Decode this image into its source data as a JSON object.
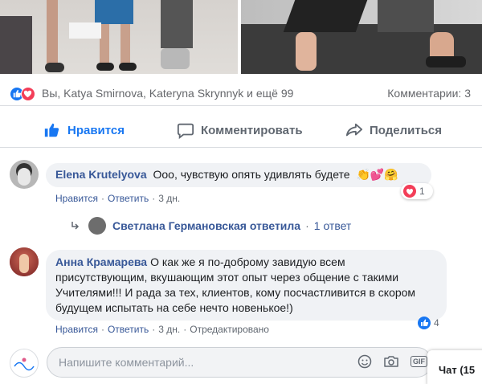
{
  "reactions": {
    "names": "Вы, Katya Smirnova, Kateryna Skrynnyk и ещё 99",
    "comments_count": "Комментарии: 3"
  },
  "actions": {
    "like": "Нравится",
    "comment": "Комментировать",
    "share": "Поделиться"
  },
  "comments": [
    {
      "author": "Elena Krutelyova",
      "text": "Ооо, чувствую опять удивлять будете",
      "emoji": "👏💕🤗",
      "like_label": "Нравится",
      "reply_label": "Ответить",
      "time": "3 дн.",
      "reaction_count": "1"
    },
    {
      "author": "Анна Крамарева",
      "text": "О как же я по-доброму завидую всем присутствующим, вкушающим этот опыт через общение с такими Учителями!!! И рада за тех, клиентов, кому посчастливится в скором будущем испытать на себе нечто новенькое!)",
      "like_label": "Нравится",
      "reply_label": "Ответить",
      "time": "3 дн.",
      "edited": "Отредактировано",
      "reaction_count": "4"
    }
  ],
  "reply_thread": {
    "text": "Светлана Германовская ответила",
    "count": "1 ответ"
  },
  "composer": {
    "placeholder": "Напишите комментарий...",
    "gif": "GIF"
  },
  "chat": {
    "label": "Чат (15"
  },
  "colors": {
    "link": "#385898",
    "like_blue": "#1877f2",
    "love_red": "#f33e58",
    "bubble_bg": "#f0f2f5"
  }
}
